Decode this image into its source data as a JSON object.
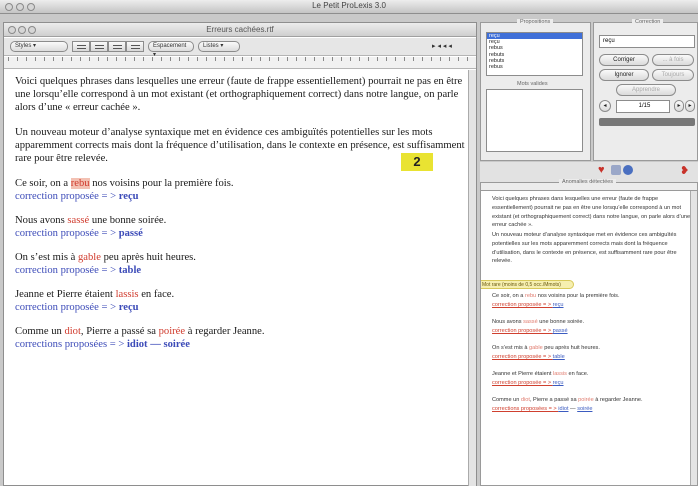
{
  "app": {
    "title": "Le Petit ProLexis 3.0"
  },
  "document": {
    "title": "Erreurs cachées.rtf",
    "toolbar": {
      "styles": "Styles",
      "spacing": "Espacement",
      "lists": "Listes"
    },
    "intro_1": "Voici quelques phrases dans lesquelles une erreur (faute de frappe essentiellement) pourrait ne pas en être une lorsqu’elle correspond à un mot existant (et orthographiquement correct) dans notre langue, on parle alors d’une « erreur cachée ».",
    "intro_2": "Un nouveau moteur d’analyse syntaxique met en évidence ces ambiguïtés potentielles sur les mots apparemment corrects mais dont la fréquence d’utilisation, dans le contexte en présence, est suffisamment rare pour être relevée.",
    "sentences": [
      {
        "before": "Ce soir, on a ",
        "error": "rebu",
        "after": " nos voisins pour la première fois.",
        "correction_label": "correction proposée = > ",
        "correction": "reçu"
      },
      {
        "before": "Nous avons ",
        "error": "sassé",
        "after": " une bonne soirée.",
        "correction_label": "correction proposée = > ",
        "correction": "passé"
      },
      {
        "before": "On s’est mis à ",
        "error": "gable",
        "after": " peu après huit heures.",
        "correction_label": "correction proposée = > ",
        "correction": "table"
      },
      {
        "before": "Jeanne et Pierre étaient ",
        "error": "lassis",
        "after": " en face.",
        "correction_label": "correction proposée = > ",
        "correction": "reçu"
      }
    ],
    "last": {
      "a": "Comme un ",
      "err1": "diot",
      "b": ", Pierre a passé sa ",
      "err2": "poirée",
      "c": " à regarder Jeanne.",
      "correction_label": "corrections proposées = > ",
      "corr1": "idiot",
      "sep": " — ",
      "corr2": "soirée"
    },
    "badge": "2"
  },
  "propositions": {
    "legend": "Propositions",
    "items": [
      "reçu",
      "reçu",
      "rebus",
      "rebuts",
      "rebuts",
      "rebus"
    ],
    "selected": 0,
    "mots_valides": "Mots valides"
  },
  "correction": {
    "legend": "Correction",
    "value": "reçu",
    "corriger": "Corriger",
    "a_fois": "... à fois",
    "ignorer": "Ignorer",
    "toujours": "Toujours",
    "apprendre": "Apprendre",
    "counter": "1/15"
  },
  "anomalies": {
    "legend": "Anomalies détectées",
    "pill": "Mot rare (moins de 0,5 occ./Mmots)"
  },
  "colors": {
    "error": "#d03a2c",
    "correction": "#3c4bb8",
    "highlight": "#f3c1b3",
    "badge": "#e9e332"
  },
  "icons": [
    "heart-icon",
    "shield-icon",
    "globe-icon",
    "bookmark-icon"
  ]
}
